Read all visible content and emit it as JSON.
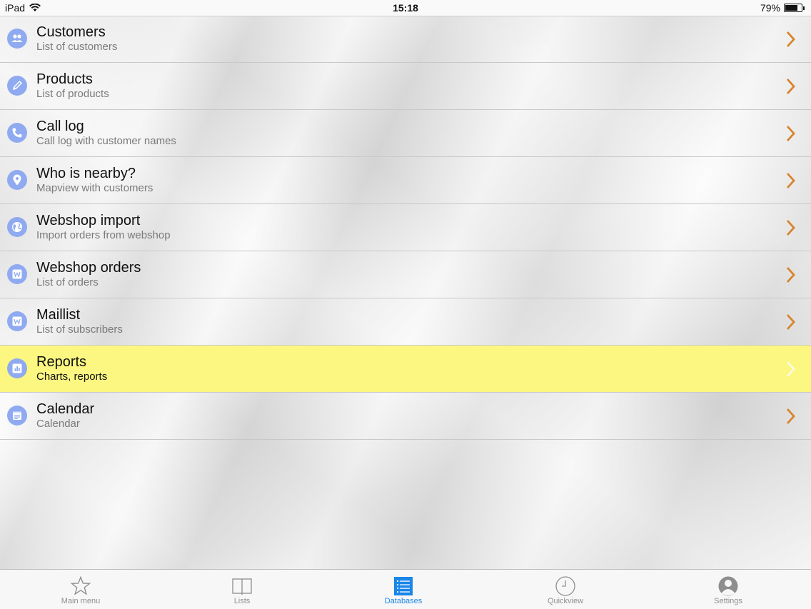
{
  "status_bar": {
    "device": "iPad",
    "time": "15:18",
    "battery_percent": "79%",
    "battery_level": 0.79
  },
  "menu": {
    "items": [
      {
        "title": "Customers",
        "subtitle": "List of customers",
        "icon": "people-icon"
      },
      {
        "title": "Products",
        "subtitle": "List of products",
        "icon": "pencil-icon"
      },
      {
        "title": "Call log",
        "subtitle": "Call log with customer names",
        "icon": "phone-icon"
      },
      {
        "title": "Who is nearby?",
        "subtitle": "Mapview with customers",
        "icon": "location-pin-icon"
      },
      {
        "title": "Webshop import",
        "subtitle": "Import orders from webshop",
        "icon": "globe-icon"
      },
      {
        "title": "Webshop orders",
        "subtitle": "List of orders",
        "icon": "w-badge-icon"
      },
      {
        "title": "Maillist",
        "subtitle": "List of subscribers",
        "icon": "w-badge-icon"
      },
      {
        "title": "Reports",
        "subtitle": "Charts, reports",
        "icon": "bar-chart-icon",
        "selected": true
      },
      {
        "title": "Calendar",
        "subtitle": "Calendar",
        "icon": "calendar-icon"
      }
    ]
  },
  "tab_bar": {
    "tabs": [
      {
        "label": "Main menu",
        "icon": "star-icon"
      },
      {
        "label": "Lists",
        "icon": "book-icon"
      },
      {
        "label": "Databases",
        "icon": "list-icon",
        "active": true
      },
      {
        "label": "Quickview",
        "icon": "clock-icon"
      },
      {
        "label": "Settings",
        "icon": "person-icon"
      }
    ]
  },
  "colors": {
    "accent": "#1a86e8",
    "chevron": "#d9832b",
    "icon_bg": "#8faaf0",
    "highlight": "#fbf781"
  }
}
